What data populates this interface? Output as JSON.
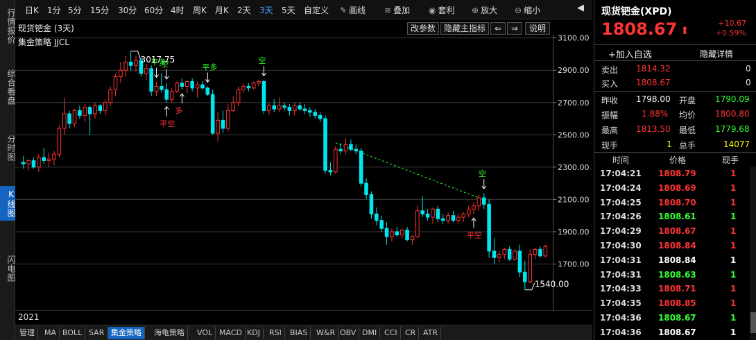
{
  "leftnav": [
    {
      "label": "行情报价",
      "active": false
    },
    {
      "label": "综合看盘",
      "active": false
    },
    {
      "label": "分时图",
      "active": false
    },
    {
      "label": "K线图",
      "active": true
    },
    {
      "label": "闪电图",
      "active": false
    }
  ],
  "toolbar": {
    "periods": [
      "日K",
      "1分",
      "5分",
      "15分",
      "30分",
      "60分",
      "4时",
      "周K",
      "月K",
      "2天",
      "3天",
      "5天",
      "自定义"
    ],
    "active_period": "3天",
    "tools": [
      {
        "label": "画线",
        "icon": "pencil-icon"
      },
      {
        "label": "叠加",
        "icon": "layers-icon"
      },
      {
        "label": "套利",
        "icon": "coin-icon"
      },
      {
        "label": "放大",
        "icon": "zoom-in-icon"
      },
      {
        "label": "缩小",
        "icon": "zoom-out-icon"
      }
    ]
  },
  "chart": {
    "title": "现货钯金 (3天)",
    "strategy": "集金策略 JJCL",
    "buttons": {
      "edit_params": "改参数",
      "hide_indicator": "隐藏主指标",
      "prev": "⇐",
      "next": "⇒",
      "help": "说明"
    },
    "year": "2021",
    "high_label": "3017.75",
    "low_label": "1540.00",
    "signals": [
      "平多",
      "空",
      "多",
      "平空",
      "平多",
      "空",
      "空",
      "平空"
    ]
  },
  "chart_data": {
    "type": "candlestick",
    "ylim": [
      1400,
      3200
    ],
    "yticks": [
      3100,
      2900,
      2700,
      2500,
      2300,
      2100,
      1900,
      1700
    ],
    "ytick_labels": [
      "3100.00",
      "2900.00",
      "2700.00",
      "2500.00",
      "2300.00",
      "2100.00",
      "1900.00",
      "1700.00"
    ],
    "high": 3017.75,
    "low": 1540.0,
    "candles": [
      {
        "o": 2330,
        "h": 2370,
        "l": 2290,
        "c": 2320
      },
      {
        "o": 2320,
        "h": 2350,
        "l": 2280,
        "c": 2340
      },
      {
        "o": 2340,
        "h": 2360,
        "l": 2290,
        "c": 2300
      },
      {
        "o": 2300,
        "h": 2380,
        "l": 2270,
        "c": 2360
      },
      {
        "o": 2360,
        "h": 2420,
        "l": 2320,
        "c": 2340
      },
      {
        "o": 2340,
        "h": 2390,
        "l": 2300,
        "c": 2350
      },
      {
        "o": 2350,
        "h": 2400,
        "l": 2310,
        "c": 2380
      },
      {
        "o": 2380,
        "h": 2560,
        "l": 2360,
        "c": 2540
      },
      {
        "o": 2540,
        "h": 2730,
        "l": 2500,
        "c": 2630
      },
      {
        "o": 2630,
        "h": 2650,
        "l": 2540,
        "c": 2570
      },
      {
        "o": 2570,
        "h": 2660,
        "l": 2550,
        "c": 2650
      },
      {
        "o": 2650,
        "h": 2680,
        "l": 2600,
        "c": 2620
      },
      {
        "o": 2620,
        "h": 2690,
        "l": 2580,
        "c": 2670
      },
      {
        "o": 2670,
        "h": 2680,
        "l": 2500,
        "c": 2630
      },
      {
        "o": 2630,
        "h": 2700,
        "l": 2600,
        "c": 2680
      },
      {
        "o": 2680,
        "h": 2690,
        "l": 2630,
        "c": 2650
      },
      {
        "o": 2650,
        "h": 2720,
        "l": 2620,
        "c": 2700
      },
      {
        "o": 2700,
        "h": 2800,
        "l": 2680,
        "c": 2780
      },
      {
        "o": 2780,
        "h": 2880,
        "l": 2740,
        "c": 2860
      },
      {
        "o": 2860,
        "h": 2950,
        "l": 2820,
        "c": 2900
      },
      {
        "o": 2900,
        "h": 2990,
        "l": 2860,
        "c": 2950
      },
      {
        "o": 2950,
        "h": 3017.75,
        "l": 2900,
        "c": 2930
      },
      {
        "o": 2930,
        "h": 2990,
        "l": 2890,
        "c": 2960
      },
      {
        "o": 2960,
        "h": 2980,
        "l": 2860,
        "c": 2880
      },
      {
        "o": 2880,
        "h": 2940,
        "l": 2840,
        "c": 2910
      },
      {
        "o": 2910,
        "h": 2930,
        "l": 2740,
        "c": 2770
      },
      {
        "o": 2770,
        "h": 2830,
        "l": 2740,
        "c": 2800
      },
      {
        "o": 2800,
        "h": 2880,
        "l": 2760,
        "c": 2780
      },
      {
        "o": 2780,
        "h": 2820,
        "l": 2700,
        "c": 2720
      },
      {
        "o": 2720,
        "h": 2790,
        "l": 2700,
        "c": 2770
      },
      {
        "o": 2770,
        "h": 2830,
        "l": 2760,
        "c": 2820
      },
      {
        "o": 2820,
        "h": 2850,
        "l": 2780,
        "c": 2800
      },
      {
        "o": 2800,
        "h": 2840,
        "l": 2760,
        "c": 2830
      },
      {
        "o": 2830,
        "h": 2850,
        "l": 2770,
        "c": 2790
      },
      {
        "o": 2790,
        "h": 2830,
        "l": 2730,
        "c": 2810
      },
      {
        "o": 2810,
        "h": 2830,
        "l": 2780,
        "c": 2790
      },
      {
        "o": 2790,
        "h": 2800,
        "l": 2740,
        "c": 2750
      },
      {
        "o": 2750,
        "h": 2780,
        "l": 2500,
        "c": 2510
      },
      {
        "o": 2510,
        "h": 2640,
        "l": 2460,
        "c": 2590
      },
      {
        "o": 2590,
        "h": 2650,
        "l": 2510,
        "c": 2540
      },
      {
        "o": 2540,
        "h": 2690,
        "l": 2520,
        "c": 2650
      },
      {
        "o": 2650,
        "h": 2740,
        "l": 2640,
        "c": 2700
      },
      {
        "o": 2700,
        "h": 2800,
        "l": 2680,
        "c": 2780
      },
      {
        "o": 2780,
        "h": 2820,
        "l": 2760,
        "c": 2800
      },
      {
        "o": 2800,
        "h": 2820,
        "l": 2770,
        "c": 2790
      },
      {
        "o": 2790,
        "h": 2830,
        "l": 2780,
        "c": 2820
      },
      {
        "o": 2820,
        "h": 2840,
        "l": 2800,
        "c": 2830
      },
      {
        "o": 2830,
        "h": 2840,
        "l": 2630,
        "c": 2650
      },
      {
        "o": 2650,
        "h": 2700,
        "l": 2620,
        "c": 2680
      },
      {
        "o": 2680,
        "h": 2720,
        "l": 2640,
        "c": 2660
      },
      {
        "o": 2660,
        "h": 2730,
        "l": 2640,
        "c": 2680
      },
      {
        "o": 2680,
        "h": 2700,
        "l": 2650,
        "c": 2670
      },
      {
        "o": 2670,
        "h": 2690,
        "l": 2620,
        "c": 2650
      },
      {
        "o": 2650,
        "h": 2700,
        "l": 2620,
        "c": 2680
      },
      {
        "o": 2680,
        "h": 2700,
        "l": 2650,
        "c": 2660
      },
      {
        "o": 2660,
        "h": 2690,
        "l": 2630,
        "c": 2650
      },
      {
        "o": 2650,
        "h": 2670,
        "l": 2610,
        "c": 2640
      },
      {
        "o": 2640,
        "h": 2660,
        "l": 2600,
        "c": 2620
      },
      {
        "o": 2620,
        "h": 2640,
        "l": 2580,
        "c": 2600
      },
      {
        "o": 2600,
        "h": 2620,
        "l": 2260,
        "c": 2280
      },
      {
        "o": 2280,
        "h": 2330,
        "l": 2250,
        "c": 2270
      },
      {
        "o": 2270,
        "h": 2430,
        "l": 2260,
        "c": 2410
      },
      {
        "o": 2410,
        "h": 2450,
        "l": 2380,
        "c": 2400
      },
      {
        "o": 2400,
        "h": 2480,
        "l": 2380,
        "c": 2440
      },
      {
        "o": 2440,
        "h": 2470,
        "l": 2400,
        "c": 2410
      },
      {
        "o": 2410,
        "h": 2440,
        "l": 2380,
        "c": 2400
      },
      {
        "o": 2400,
        "h": 2420,
        "l": 2180,
        "c": 2200
      },
      {
        "o": 2200,
        "h": 2230,
        "l": 2100,
        "c": 2130
      },
      {
        "o": 2130,
        "h": 2150,
        "l": 1980,
        "c": 2010
      },
      {
        "o": 2010,
        "h": 2050,
        "l": 1940,
        "c": 1970
      },
      {
        "o": 1970,
        "h": 2000,
        "l": 1900,
        "c": 1920
      },
      {
        "o": 1920,
        "h": 1960,
        "l": 1820,
        "c": 1870
      },
      {
        "o": 1870,
        "h": 1920,
        "l": 1840,
        "c": 1900
      },
      {
        "o": 1900,
        "h": 1930,
        "l": 1870,
        "c": 1880
      },
      {
        "o": 1880,
        "h": 1920,
        "l": 1860,
        "c": 1910
      },
      {
        "o": 1910,
        "h": 1930,
        "l": 1840,
        "c": 1850
      },
      {
        "o": 1850,
        "h": 1880,
        "l": 1820,
        "c": 1870
      },
      {
        "o": 1870,
        "h": 2060,
        "l": 1860,
        "c": 2030
      },
      {
        "o": 2030,
        "h": 2120,
        "l": 1990,
        "c": 2010
      },
      {
        "o": 2010,
        "h": 2040,
        "l": 1970,
        "c": 1990
      },
      {
        "o": 1990,
        "h": 2050,
        "l": 1950,
        "c": 2040
      },
      {
        "o": 2040,
        "h": 2060,
        "l": 1960,
        "c": 1980
      },
      {
        "o": 1980,
        "h": 2010,
        "l": 1950,
        "c": 1970
      },
      {
        "o": 1970,
        "h": 2020,
        "l": 1950,
        "c": 2000
      },
      {
        "o": 2000,
        "h": 2030,
        "l": 1960,
        "c": 1970
      },
      {
        "o": 1970,
        "h": 2010,
        "l": 1950,
        "c": 1990
      },
      {
        "o": 1990,
        "h": 2020,
        "l": 1960,
        "c": 2010
      },
      {
        "o": 2010,
        "h": 2060,
        "l": 1990,
        "c": 2040
      },
      {
        "o": 2040,
        "h": 2080,
        "l": 2010,
        "c": 2060
      },
      {
        "o": 2060,
        "h": 2130,
        "l": 2030,
        "c": 2110
      },
      {
        "o": 2110,
        "h": 2140,
        "l": 2040,
        "c": 2070
      },
      {
        "o": 2070,
        "h": 2100,
        "l": 1740,
        "c": 1780
      },
      {
        "o": 1780,
        "h": 1860,
        "l": 1700,
        "c": 1740
      },
      {
        "o": 1740,
        "h": 1780,
        "l": 1710,
        "c": 1760
      },
      {
        "o": 1760,
        "h": 1800,
        "l": 1730,
        "c": 1790
      },
      {
        "o": 1790,
        "h": 1810,
        "l": 1720,
        "c": 1730
      },
      {
        "o": 1730,
        "h": 1790,
        "l": 1720,
        "c": 1780
      },
      {
        "o": 1780,
        "h": 1820,
        "l": 1620,
        "c": 1650
      },
      {
        "o": 1650,
        "h": 1720,
        "l": 1540,
        "c": 1590
      },
      {
        "o": 1590,
        "h": 1790,
        "l": 1580,
        "c": 1760
      },
      {
        "o": 1760,
        "h": 1800,
        "l": 1730,
        "c": 1790
      },
      {
        "o": 1790,
        "h": 1810,
        "l": 1740,
        "c": 1750
      },
      {
        "o": 1750,
        "h": 1820,
        "l": 1740,
        "c": 1808.67
      }
    ]
  },
  "bottom_tabs": [
    "管理",
    "MA",
    "BOLL",
    "SAR",
    "集金策略",
    "海龟策略",
    "VOL",
    "MACD",
    "KDJ",
    "RSI",
    "BIAS",
    "W&R",
    "OBV",
    "DMI",
    "CCI",
    "CR",
    "ATR"
  ],
  "active_bottom_tab": "集金策略",
  "quote": {
    "name": "现货钯金(XPD)",
    "price": "1808.67",
    "arrow": "⬆",
    "change": "+10.67",
    "change_pct": "+0.59%",
    "add_watch": "+加入自选",
    "hide_detail": "隐藏详情",
    "sell_label": "卖出",
    "sell_price": "1814.32",
    "sell_vol": "0",
    "buy_label": "买入",
    "buy_price": "1808.67",
    "buy_vol": "0",
    "prev_close_label": "昨收",
    "prev_close": "1798.00",
    "open_label": "开盘",
    "open": "1790.09",
    "amplitude_label": "振幅",
    "amplitude": "1.88%",
    "avg_label": "均价",
    "avg": "1800.80",
    "high_label": "最高",
    "high": "1813.50",
    "low_label": "最低",
    "low": "1779.68",
    "cur_vol_label": "现手",
    "cur_vol": "1",
    "total_vol_label": "总手",
    "total_vol": "14077"
  },
  "ticks": {
    "headers": [
      "时间",
      "价格",
      "现手"
    ],
    "rows": [
      {
        "time": "17:04:21",
        "price": "1808.79",
        "vol": "1",
        "color": "red"
      },
      {
        "time": "17:04:24",
        "price": "1808.69",
        "vol": "1",
        "color": "red"
      },
      {
        "time": "17:04:25",
        "price": "1808.70",
        "vol": "1",
        "color": "red"
      },
      {
        "time": "17:04:26",
        "price": "1808.61",
        "vol": "1",
        "color": "green"
      },
      {
        "time": "17:04:29",
        "price": "1808.67",
        "vol": "1",
        "color": "red"
      },
      {
        "time": "17:04:30",
        "price": "1808.84",
        "vol": "1",
        "color": "red"
      },
      {
        "time": "17:04:31",
        "price": "1808.84",
        "vol": "1",
        "color": "white"
      },
      {
        "time": "17:04:31",
        "price": "1808.63",
        "vol": "1",
        "color": "green"
      },
      {
        "time": "17:04:33",
        "price": "1808.71",
        "vol": "1",
        "color": "red"
      },
      {
        "time": "17:04:35",
        "price": "1808.85",
        "vol": "1",
        "color": "red"
      },
      {
        "time": "17:04:36",
        "price": "1808.67",
        "vol": "1",
        "color": "green"
      },
      {
        "time": "17:04:36",
        "price": "1808.67",
        "vol": "1",
        "color": "white"
      }
    ]
  },
  "colors": {
    "up": "#ff3333",
    "down": "#00e5ee",
    "accent": "#1565c0",
    "grid": "#3a3a3a",
    "trend": "#33ff33"
  }
}
